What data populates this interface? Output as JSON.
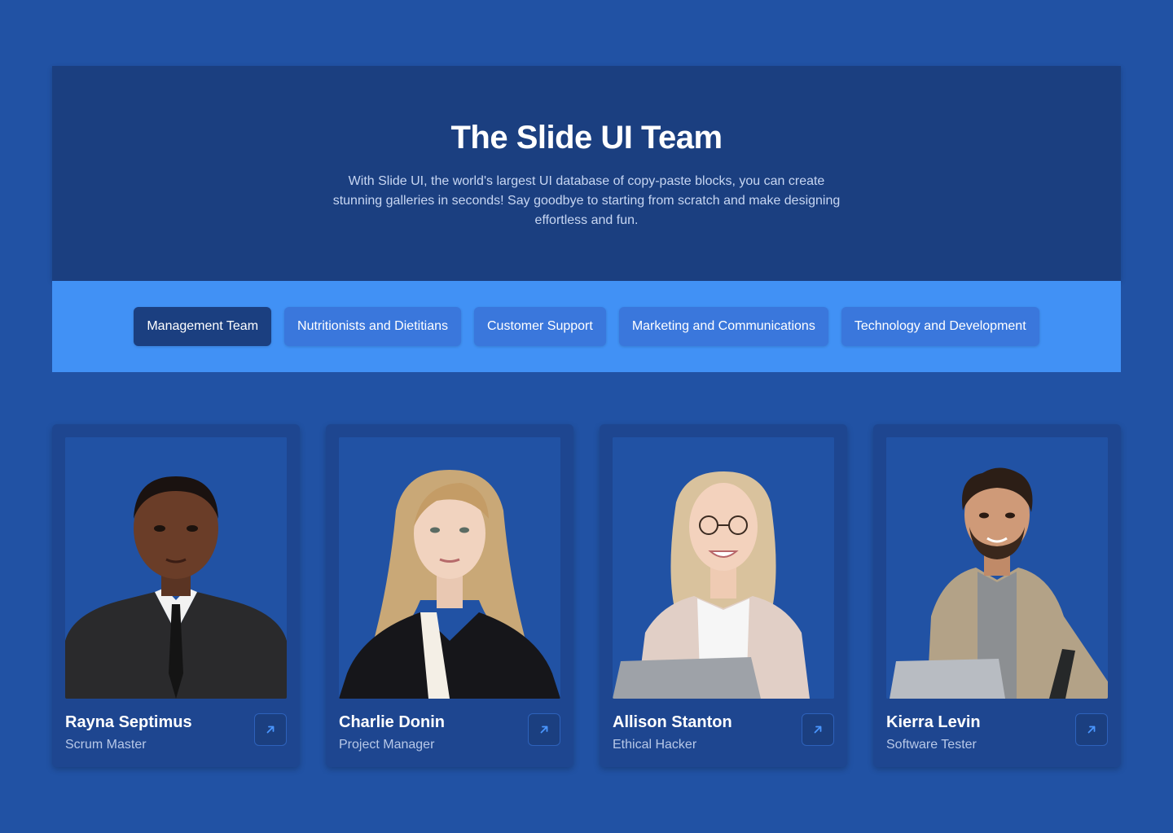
{
  "hero": {
    "title": "The Slide UI Team",
    "description": "With Slide UI, the world's largest UI database of copy-paste blocks, you can create stunning galleries in seconds! Say goodbye to starting from scratch and make designing effortless and fun."
  },
  "tabs": [
    {
      "label": "Management Team",
      "active": true
    },
    {
      "label": "Nutritionists and Dietitians",
      "active": false
    },
    {
      "label": "Customer Support",
      "active": false
    },
    {
      "label": "Marketing and Communications",
      "active": false
    },
    {
      "label": "Technology and Development",
      "active": false
    }
  ],
  "members": [
    {
      "name": "Rayna Septimus",
      "role": "Scrum Master",
      "link_icon": "arrow-up-right-icon"
    },
    {
      "name": "Charlie Donin",
      "role": "Project Manager",
      "link_icon": "arrow-up-right-icon"
    },
    {
      "name": "Allison Stanton",
      "role": "Ethical Hacker",
      "link_icon": "arrow-up-right-icon"
    },
    {
      "name": "Kierra Levin",
      "role": "Software Tester",
      "link_icon": "arrow-up-right-icon"
    }
  ],
  "colors": {
    "background": "#2152a4",
    "hero_bg": "#1b3f80",
    "tabbar_bg": "#4191f5",
    "tab_bg": "#3a77dc",
    "tab_active_bg": "#1b3f80",
    "card_bg": "#1e4690",
    "accent_icon": "#4a96ff"
  }
}
